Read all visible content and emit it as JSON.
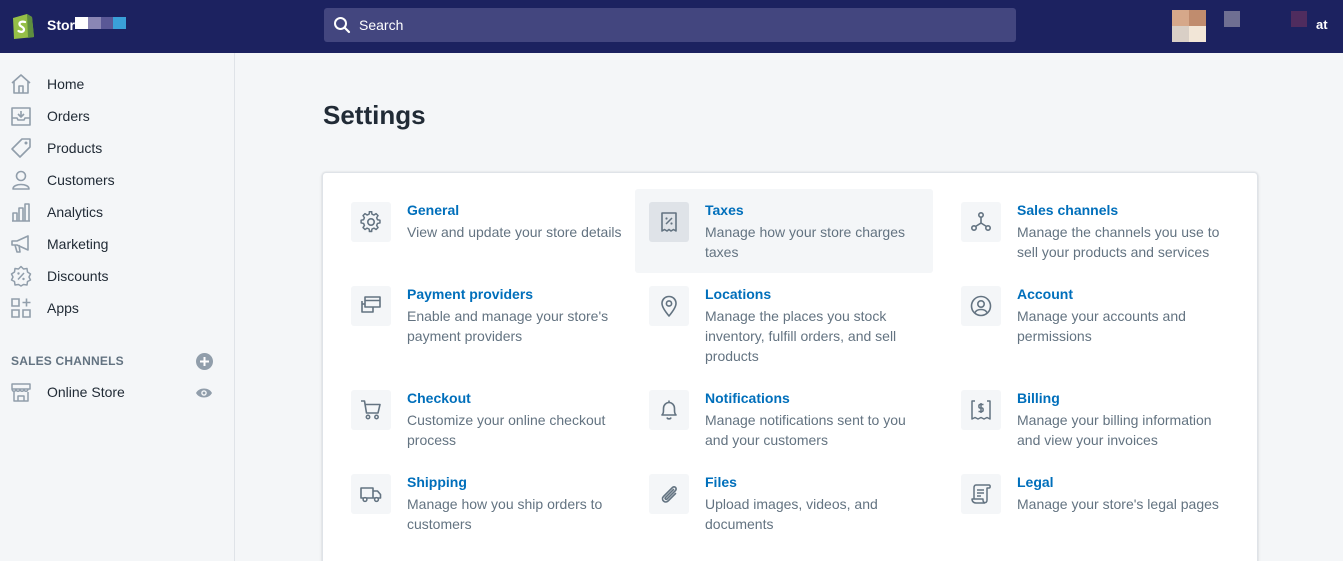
{
  "topbar": {
    "store_name": "Stor",
    "search_placeholder": "Search",
    "user_name_tail": "at"
  },
  "sidebar": {
    "items": [
      {
        "label": "Home",
        "icon": "home-icon"
      },
      {
        "label": "Orders",
        "icon": "orders-icon"
      },
      {
        "label": "Products",
        "icon": "tag-icon"
      },
      {
        "label": "Customers",
        "icon": "person-icon"
      },
      {
        "label": "Analytics",
        "icon": "bar-chart-icon"
      },
      {
        "label": "Marketing",
        "icon": "megaphone-icon"
      },
      {
        "label": "Discounts",
        "icon": "discount-icon"
      },
      {
        "label": "Apps",
        "icon": "apps-icon"
      }
    ],
    "sales_channels_title": "SALES CHANNELS",
    "channels": [
      {
        "label": "Online Store",
        "icon": "storefront-icon"
      }
    ]
  },
  "main": {
    "title": "Settings",
    "settings": [
      {
        "title": "General",
        "desc": "View and update your store details",
        "icon": "gear-icon"
      },
      {
        "title": "Taxes",
        "desc": "Manage how your store charges taxes",
        "icon": "receipt-percent-icon"
      },
      {
        "title": "Sales channels",
        "desc": "Manage the channels you use to sell your products and services",
        "icon": "channels-icon"
      },
      {
        "title": "Payment providers",
        "desc": "Enable and manage your store's payment providers",
        "icon": "credit-card-icon"
      },
      {
        "title": "Locations",
        "desc": "Manage the places you stock inventory, fulfill orders, and sell products",
        "icon": "location-pin-icon"
      },
      {
        "title": "Account",
        "desc": "Manage your accounts and permissions",
        "icon": "account-circle-icon"
      },
      {
        "title": "Checkout",
        "desc": "Customize your online checkout process",
        "icon": "cart-icon"
      },
      {
        "title": "Notifications",
        "desc": "Manage notifications sent to you and your customers",
        "icon": "bell-icon"
      },
      {
        "title": "Billing",
        "desc": "Manage your billing information and view your invoices",
        "icon": "billing-dollar-icon"
      },
      {
        "title": "Shipping",
        "desc": "Manage how you ship orders to customers",
        "icon": "truck-icon"
      },
      {
        "title": "Files",
        "desc": "Upload images, videos, and documents",
        "icon": "paperclip-icon"
      },
      {
        "title": "Legal",
        "desc": "Manage your store's legal pages",
        "icon": "legal-scroll-icon"
      }
    ]
  },
  "colors": {
    "topbar": "#1c2260",
    "search": "#43467f",
    "link": "#006fbb",
    "muted": "#637381",
    "brand_green": "#95bf47"
  }
}
